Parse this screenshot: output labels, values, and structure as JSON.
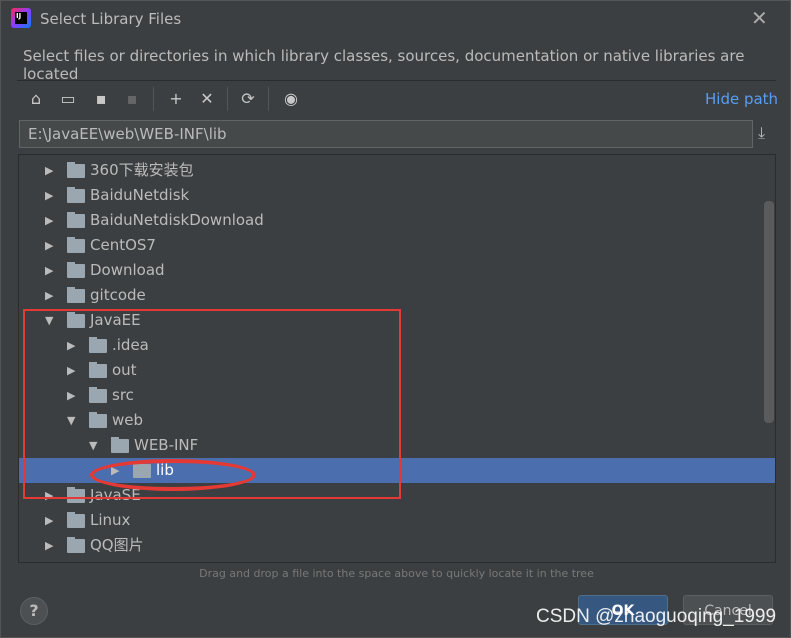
{
  "window": {
    "title": "Select Library Files",
    "close": "✕"
  },
  "description": "Select files or directories in which library classes, sources, documentation or native libraries are located",
  "toolbar": {
    "home": "⌂",
    "desktop": "▭",
    "project": "▪",
    "module": "▪",
    "new_folder": "+",
    "delete": "✕",
    "refresh": "⟳",
    "show_hidden": "◉",
    "hide_path": "Hide path"
  },
  "path": {
    "value": "E:\\JavaEE\\web\\WEB-INF\\lib",
    "download_icon": "⤓"
  },
  "tree": [
    {
      "label": "360下载安装包",
      "level": 0,
      "expanded": false
    },
    {
      "label": "BaiduNetdisk",
      "level": 0,
      "expanded": false
    },
    {
      "label": "BaiduNetdiskDownload",
      "level": 0,
      "expanded": false
    },
    {
      "label": "CentOS7",
      "level": 0,
      "expanded": false
    },
    {
      "label": "Download",
      "level": 0,
      "expanded": false
    },
    {
      "label": "gitcode",
      "level": 0,
      "expanded": false
    },
    {
      "label": "JavaEE",
      "level": 0,
      "expanded": true
    },
    {
      "label": ".idea",
      "level": 1,
      "expanded": false
    },
    {
      "label": "out",
      "level": 1,
      "expanded": false
    },
    {
      "label": "src",
      "level": 1,
      "expanded": false
    },
    {
      "label": "web",
      "level": 1,
      "expanded": true
    },
    {
      "label": "WEB-INF",
      "level": 2,
      "expanded": true
    },
    {
      "label": "lib",
      "level": 3,
      "expanded": false,
      "selected": true
    },
    {
      "label": "JavaSE",
      "level": 0,
      "expanded": false
    },
    {
      "label": "Linux",
      "level": 0,
      "expanded": false
    },
    {
      "label": "QQ图片",
      "level": 0,
      "expanded": false
    }
  ],
  "hint": "Drag and drop a file into the space above to quickly locate it in the tree",
  "buttons": {
    "help": "?",
    "ok": "OK",
    "cancel": "Cancel"
  },
  "watermark": "CSDN @zhaoguoqing_1999",
  "colors": {
    "selection": "#4b6eaf",
    "link": "#589df6",
    "annotation": "#e53935"
  }
}
